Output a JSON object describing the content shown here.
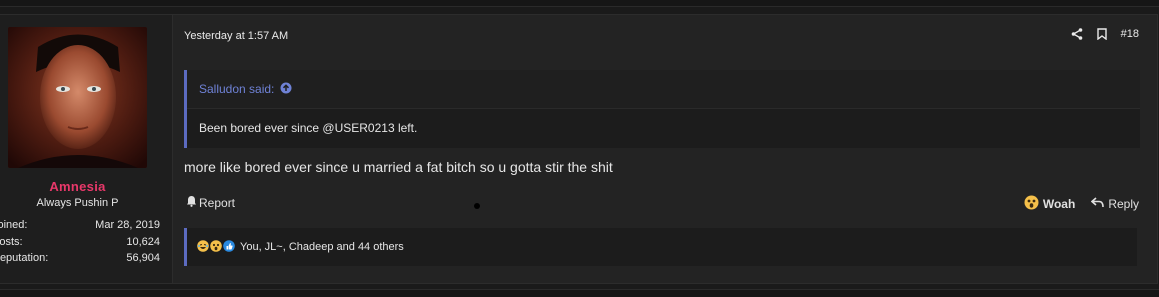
{
  "post": {
    "timestamp": "Yesterday at 1:57 AM",
    "post_number": "#18",
    "message": "more like bored ever since u married a fat bitch so u gotta stir the shit"
  },
  "user": {
    "name": "Amnesia",
    "title": "Always Pushin P",
    "stats": [
      {
        "label": "Joined:",
        "value": "Mar 28, 2019"
      },
      {
        "label": "Posts:",
        "value": "10,624"
      },
      {
        "label": "Reputation:",
        "value": "56,904"
      }
    ]
  },
  "quote": {
    "author": "Salludon said:",
    "text": "Been bored ever since @USER0213 left."
  },
  "actions": {
    "report": "Report",
    "woah": "Woah",
    "reply": "Reply"
  },
  "reactions": {
    "summary": "You, JL~, Chadeep and 44 others",
    "icons": [
      "laugh-emoji-icon",
      "woah-emoji-icon",
      "thumbs-up-icon"
    ]
  },
  "colors": {
    "username": "#e8386a",
    "quote_accent": "#5c6bc0",
    "quote_author": "#6f82d6"
  }
}
